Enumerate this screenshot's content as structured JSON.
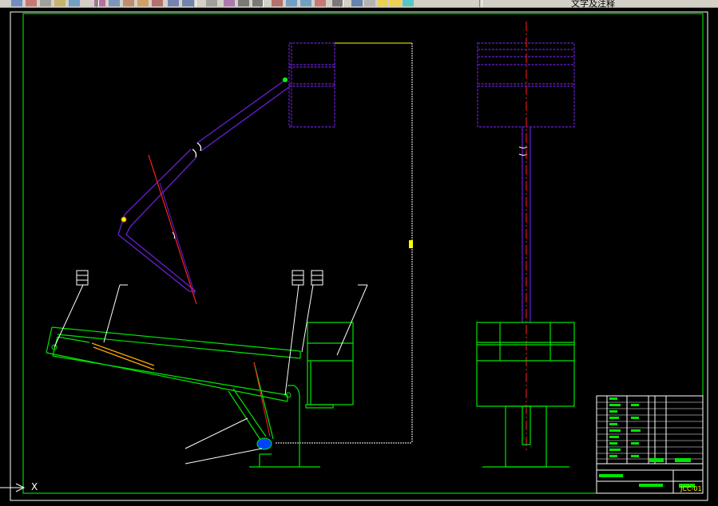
{
  "toolbar": {
    "buttons": [
      {
        "icon": "window-icon"
      },
      {
        "icon": "zoom-realtime-icon"
      },
      {
        "icon": "pan-icon"
      },
      {
        "icon": "paint-icon"
      },
      {
        "icon": "properties-icon"
      },
      {
        "icon": "cut-icon"
      },
      {
        "icon": "copy-icon"
      },
      {
        "icon": "paste-icon"
      },
      {
        "icon": "brush-icon"
      },
      {
        "icon": "match-icon"
      },
      {
        "icon": "undo-icon"
      },
      {
        "icon": "redo-icon"
      },
      {
        "icon": "pan-realtime-icon"
      },
      {
        "icon": "zoom-in-icon"
      },
      {
        "icon": "zoom-out-icon"
      },
      {
        "icon": "zoom-window-icon"
      },
      {
        "icon": "design-center-icon"
      },
      {
        "icon": "tool-palette-icon"
      },
      {
        "icon": "sheet-set-icon"
      },
      {
        "icon": "markup-icon"
      },
      {
        "icon": "calculator-icon"
      },
      {
        "icon": "help-icon"
      },
      {
        "icon": "layer-manager-icon"
      },
      {
        "icon": "lamp-icon"
      },
      {
        "icon": "sun-icon"
      },
      {
        "icon": "layer-color-icon"
      }
    ],
    "layer_name": "文字及注释"
  },
  "colors": {
    "background": "#000000",
    "frame": "#00ff00",
    "green": "#00e600",
    "purple": "#6a1fd6",
    "red": "#ff2020",
    "yellow": "#ffff00",
    "white": "#ffffff",
    "blue": "#0040ff"
  },
  "drawing": {
    "ucs_label": "X",
    "title_block": {
      "drawing_no": "JCC-01"
    }
  }
}
